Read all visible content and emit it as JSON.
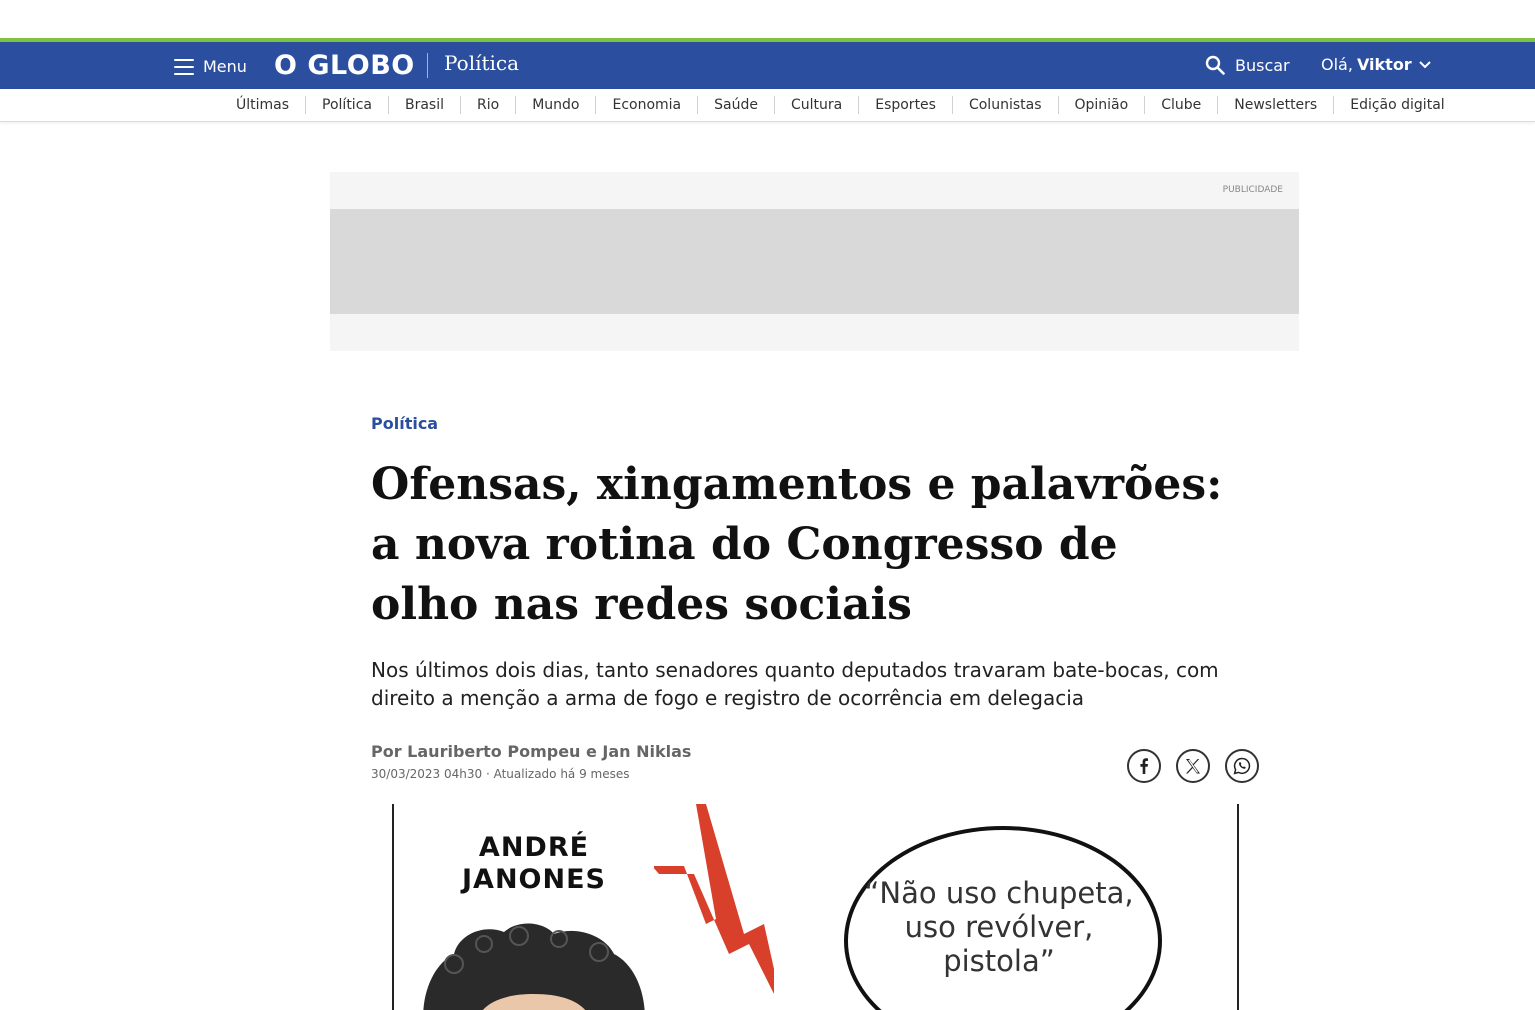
{
  "header": {
    "menu_label": "Menu",
    "logo": "O GLOBO",
    "section": "Política",
    "search_label": "Buscar",
    "greeting": "Olá,",
    "user_name": "Viktor",
    "brand_color": "#2b4f9e",
    "accent_strip_color": "#7ec242"
  },
  "subnav": [
    "Últimas",
    "Política",
    "Brasil",
    "Rio",
    "Mundo",
    "Economia",
    "Saúde",
    "Cultura",
    "Esportes",
    "Colunistas",
    "Opinião",
    "Clube",
    "Newsletters",
    "Edição digital"
  ],
  "ad": {
    "label": "PUBLICIDADE"
  },
  "article": {
    "kicker": "Política",
    "headline": "Ofensas, xingamentos e palavrões: a nova rotina do Congresso de olho nas redes sociais",
    "subtitle": "Nos últimos dois dias, tanto senadores quanto deputados travaram bate-bocas, com direito a menção a arma de fogo e registro de ocorrência em delegacia",
    "byline": "Por Lauriberto Pompeu e Jan Niklas",
    "dateline": "30/03/2023 04h30 · Atualizado há 9 meses",
    "share": [
      "facebook-icon",
      "x-icon",
      "whatsapp-icon"
    ]
  },
  "figure": {
    "name_line1": "ANDRÉ",
    "name_line2": "JANONES",
    "quote": "“Não uso chupeta, uso revólver, pistola”",
    "bolt_color": "#d9402b"
  }
}
